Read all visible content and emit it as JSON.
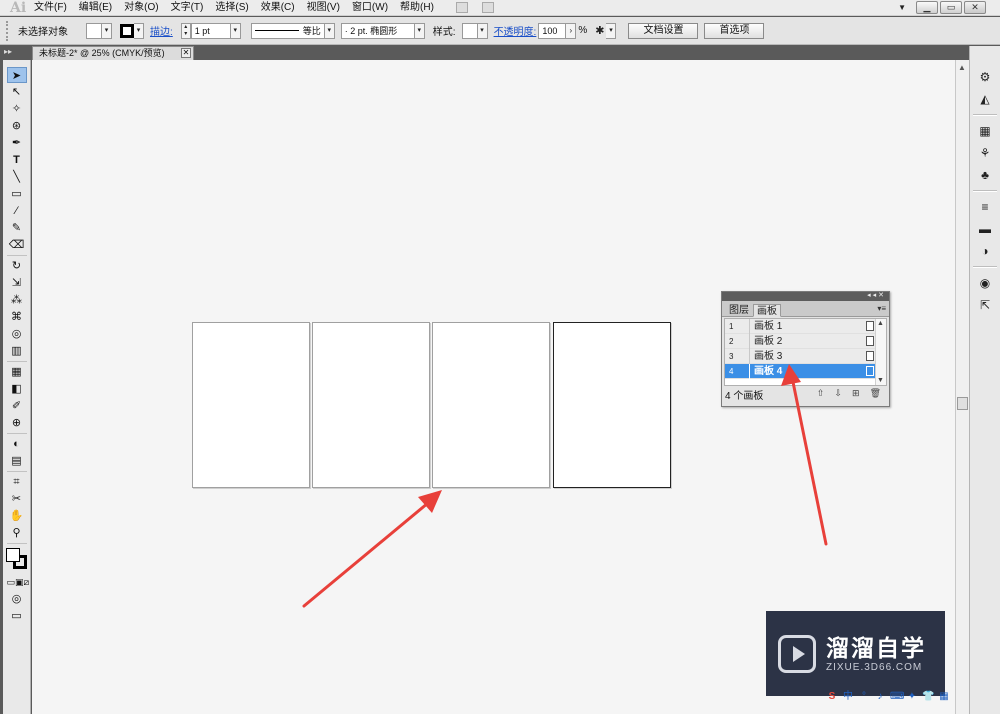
{
  "app": {
    "logo": "Ai"
  },
  "menu": {
    "items": [
      "文件(F)",
      "编辑(E)",
      "对象(O)",
      "文字(T)",
      "选择(S)",
      "效果(C)",
      "视图(V)",
      "窗口(W)",
      "帮助(H)"
    ]
  },
  "window_controls": {
    "minimize": "▁",
    "restore": "▭",
    "close": "✕",
    "dropdown": "▼"
  },
  "controlbar": {
    "selection": "未选择对象",
    "stroke_label": "描边:",
    "stroke_weight": "1 pt",
    "stroke_profile": "等比",
    "brush": "2 pt. 椭圆形",
    "style_label": "样式:",
    "opacity_label": "不透明度:",
    "opacity_value": "100",
    "opacity_unit": "%",
    "doc_setup_button": "文档设置",
    "preferences_button": "首选项"
  },
  "document": {
    "tab_title": "未标题-2* @ 25% (CMYK/预览)",
    "tab_close": "✕"
  },
  "tools": [
    "➤",
    "↖",
    "✧",
    "⊛",
    "✒",
    "T",
    "╲",
    "▭",
    "∕",
    "✎",
    "⌫",
    "↻",
    "⇲",
    "⁂",
    "⌘",
    "◎",
    "▥",
    "▦",
    "◧",
    "✐",
    "⊕",
    "◐",
    "▤",
    "⌗",
    "✂",
    "✋",
    "⚲"
  ],
  "artboards_panel": {
    "tabs": [
      "图层",
      "画板"
    ],
    "active_tab": "画板",
    "rows": [
      {
        "num": "1",
        "name": "画板 1"
      },
      {
        "num": "2",
        "name": "画板 2"
      },
      {
        "num": "3",
        "name": "画板 3"
      },
      {
        "num": "4",
        "name": "画板 4"
      }
    ],
    "selected_index": 3,
    "footer_count": "4 个画板",
    "footer_buttons": [
      "⇧",
      "⇩",
      "⊞",
      "🗑"
    ]
  },
  "dock_icons": [
    "⚙",
    "◭",
    "▦",
    "⚘",
    "♣",
    "≡",
    "▬",
    "◑",
    "◉",
    "⇱"
  ],
  "watermark": {
    "brand": "溜溜自学",
    "url": "ZIXUE.3D66.COM"
  },
  "colors": {
    "arrow": "#e8403a",
    "selection": "#3b8fe6",
    "watermark_bg": "#2c3346"
  }
}
